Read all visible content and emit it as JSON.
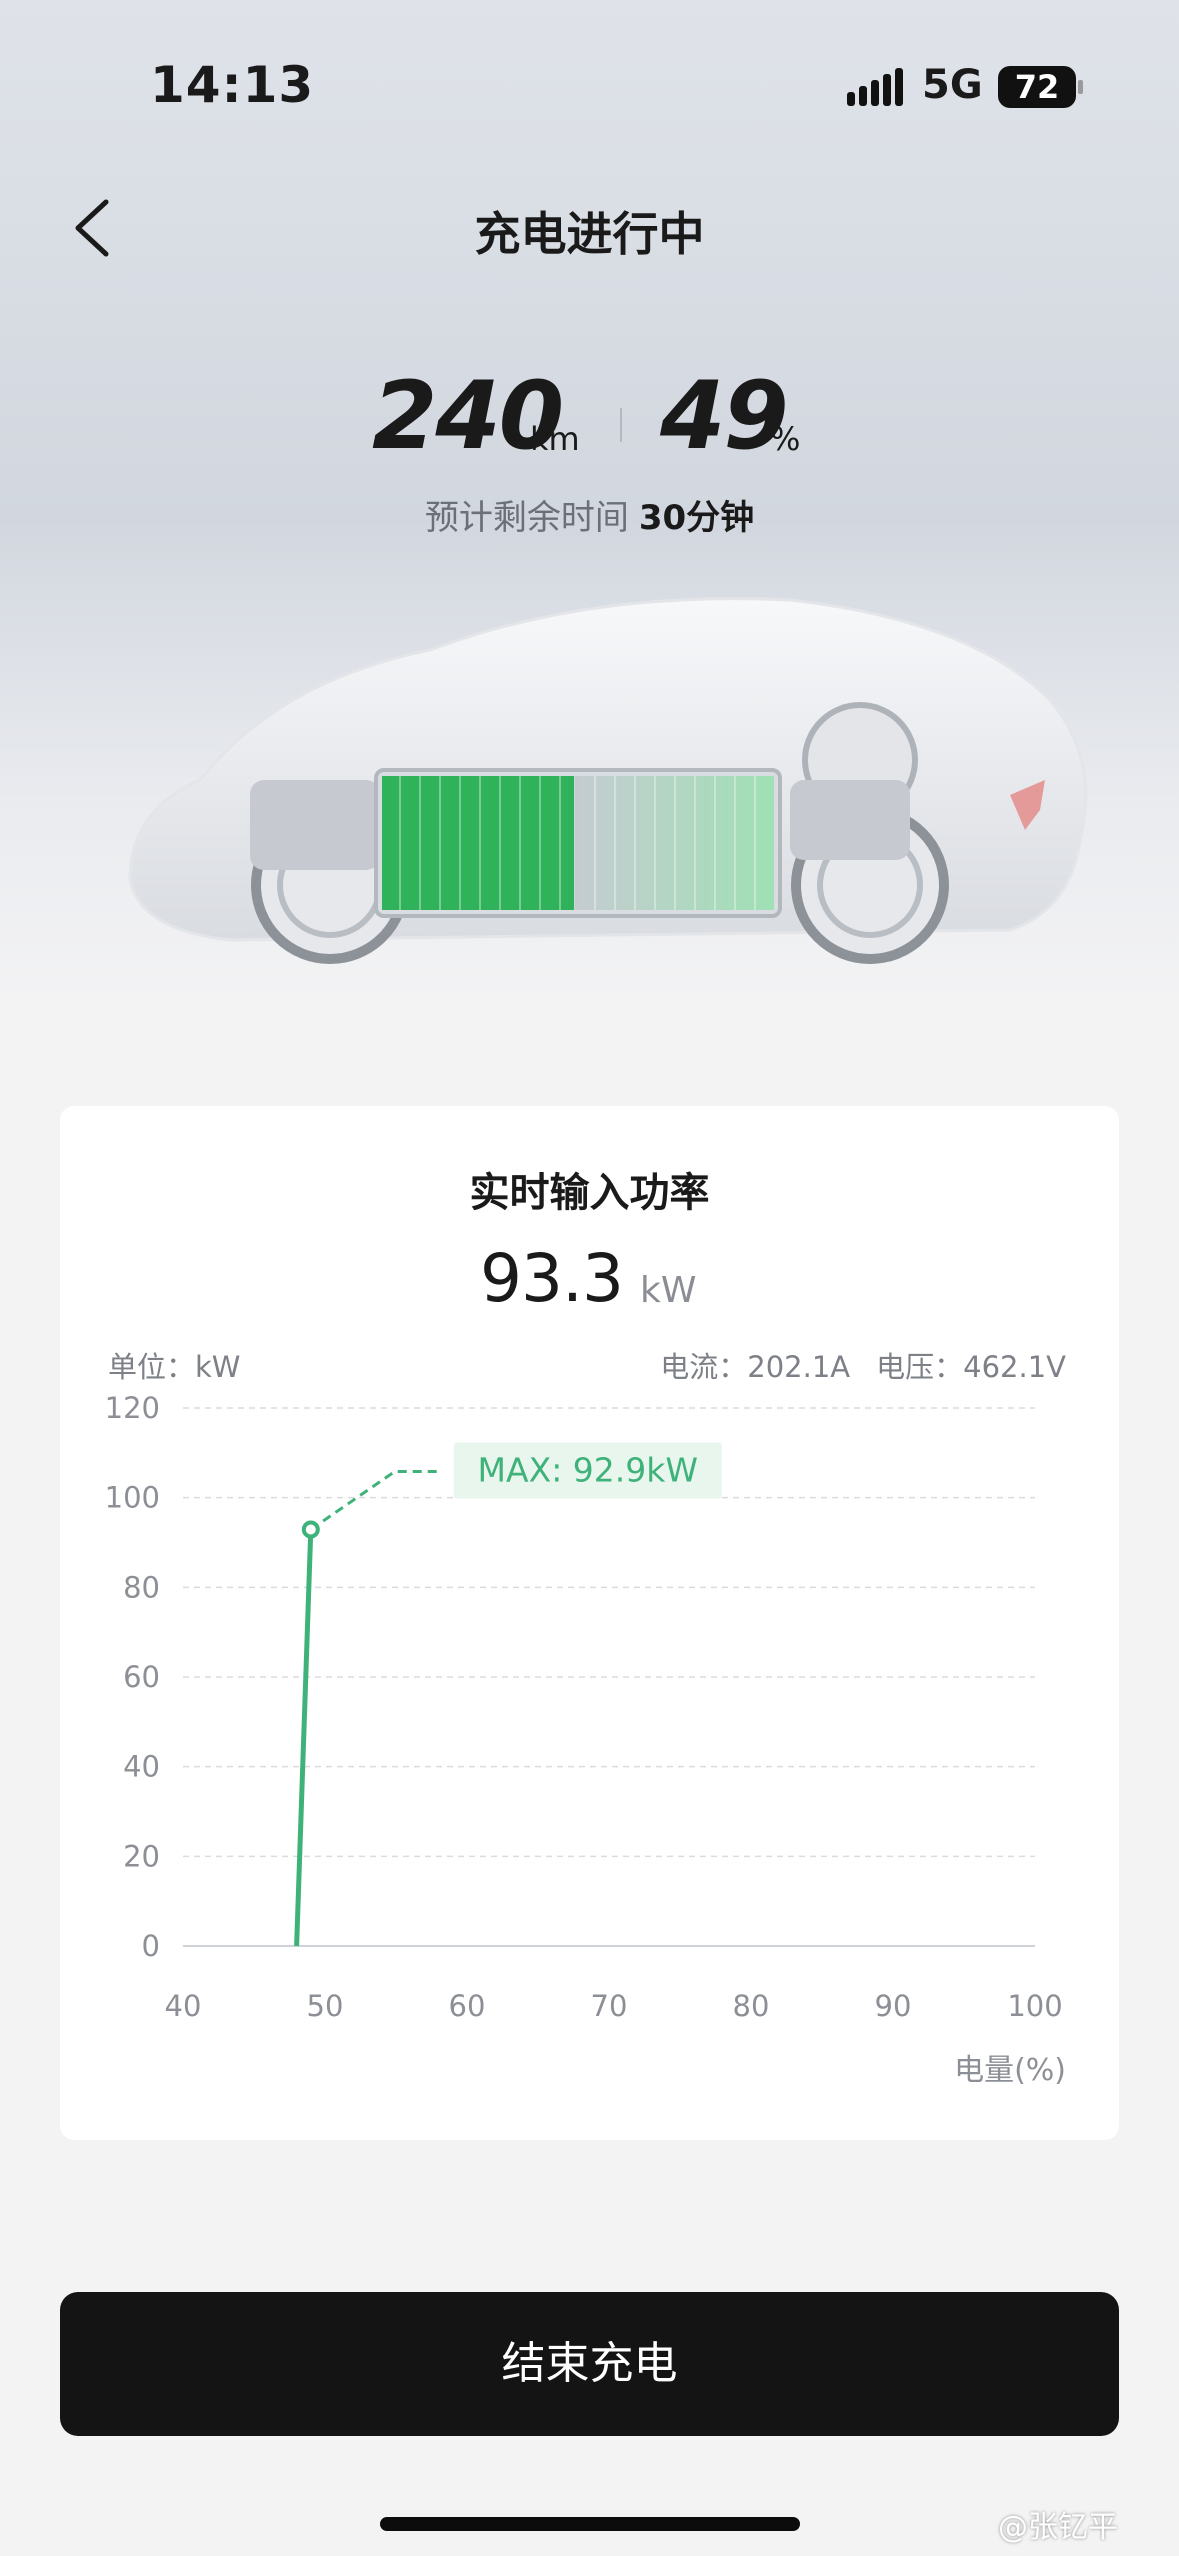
{
  "status_bar": {
    "time": "14:13",
    "network": "5G",
    "battery": "72"
  },
  "header": {
    "title": "充电进行中",
    "back_icon": "chevron-left-icon"
  },
  "stats": {
    "range_value": "240",
    "range_unit": "km",
    "battery_value": "49",
    "battery_unit": "%",
    "remaining_label": "预计剩余时间",
    "remaining_value": "30分钟",
    "battery_fill_fraction": 0.49
  },
  "power_card": {
    "title": "实时输入功率",
    "value": "93.3",
    "unit": "kW",
    "unit_label": "单位：kW",
    "current_label": "电流：202.1A",
    "voltage_label": "电压：462.1V"
  },
  "chart_data": {
    "type": "line",
    "xlabel": "电量(%)",
    "ylabel": "",
    "xlim": [
      40,
      100
    ],
    "ylim": [
      0,
      120
    ],
    "x_ticks": [
      "40",
      "50",
      "60",
      "70",
      "80",
      "90",
      "100"
    ],
    "y_ticks": [
      "120",
      "100",
      "80",
      "60",
      "40",
      "20",
      "0"
    ],
    "grid": true,
    "series": [
      {
        "x": [
          48,
          49
        ],
        "y": [
          0,
          92.9
        ]
      }
    ],
    "annotation": {
      "text": "MAX: 92.9kW",
      "x": 49,
      "y": 92.9
    },
    "colors": {
      "line": "#3fb27a",
      "grid": "#d9dbe0",
      "tick": "#8c8f95"
    }
  },
  "actions": {
    "end_charging": "结束充电"
  },
  "watermark": "@张钇平"
}
